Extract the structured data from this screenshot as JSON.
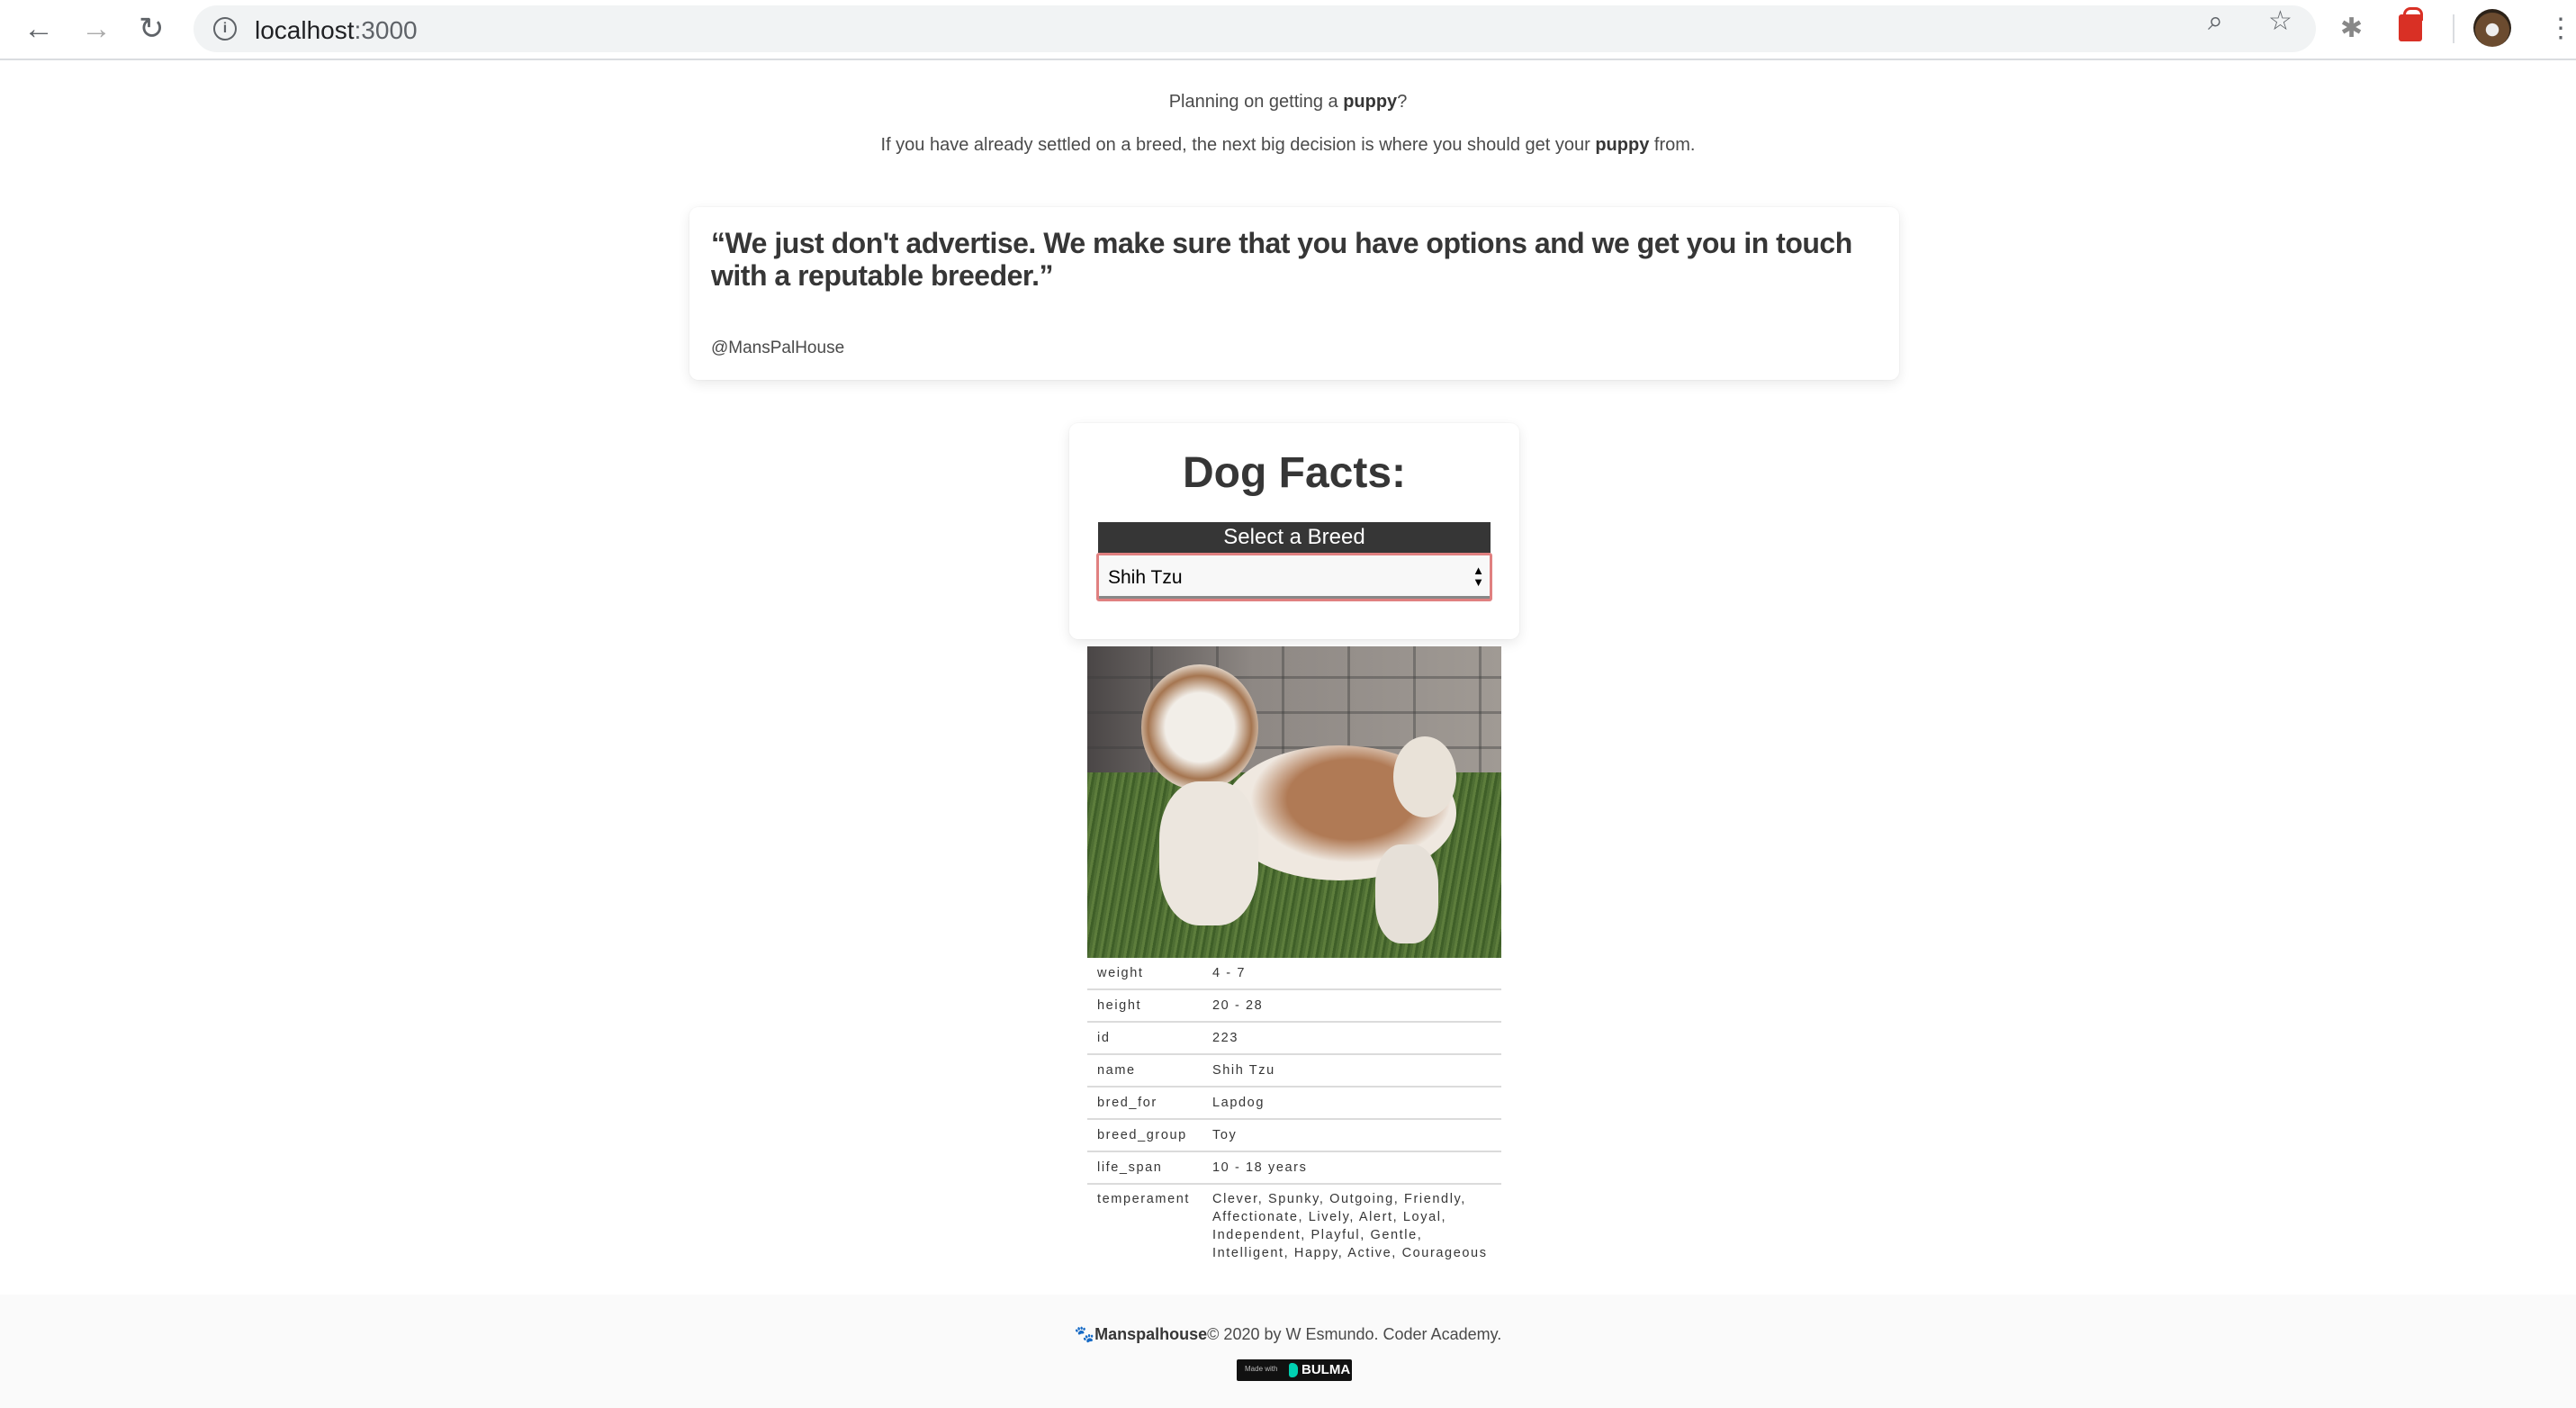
{
  "browser": {
    "url_host": "localhost",
    "url_port": ":3000",
    "icons": [
      "back-arrow-icon",
      "forward-arrow-icon",
      "reload-icon",
      "info-icon",
      "zoom-icon",
      "star-icon",
      "bug-extension-icon",
      "lock-extension-icon",
      "profile-avatar",
      "menu-dots-icon"
    ]
  },
  "intro": {
    "line1_pre": "Planning on getting a ",
    "line1_bold": "puppy",
    "line1_post": "?",
    "line2_pre": "If you have already settled on a breed, the next big decision is where you should get your ",
    "line2_bold": "puppy",
    "line2_post": " from."
  },
  "quote": {
    "text": "“We just don't advertise. We make sure that you have options and we get you in touch with a reputable breeder.”",
    "author": "@MansPalHouse"
  },
  "facts": {
    "title": "Dog Facts:",
    "select_label": "Select a Breed",
    "selected_breed": "Shih Tzu",
    "rows": [
      {
        "key": "weight",
        "value": "4 - 7"
      },
      {
        "key": "height",
        "value": "20 - 28"
      },
      {
        "key": "id",
        "value": "223"
      },
      {
        "key": "name",
        "value": "Shih Tzu"
      },
      {
        "key": "bred_for",
        "value": "Lapdog"
      },
      {
        "key": "breed_group",
        "value": "Toy"
      },
      {
        "key": "life_span",
        "value": "10 - 18 years"
      },
      {
        "key": "temperament",
        "value": "Clever, Spunky, Outgoing, Friendly, Affectionate, Lively, Alert, Loyal, Independent, Playful, Gentle, Intelligent, Happy, Active, Courageous"
      }
    ]
  },
  "footer": {
    "brand": "Manspalhouse",
    "rest": "© 2020 by W Esmundo. Coder Academy.",
    "badge_made": "Made with",
    "badge_brand": "BULMA"
  },
  "colors": {
    "accent_dark": "#363636",
    "select_border": "#e08080",
    "bulma": "#00d1b2"
  }
}
